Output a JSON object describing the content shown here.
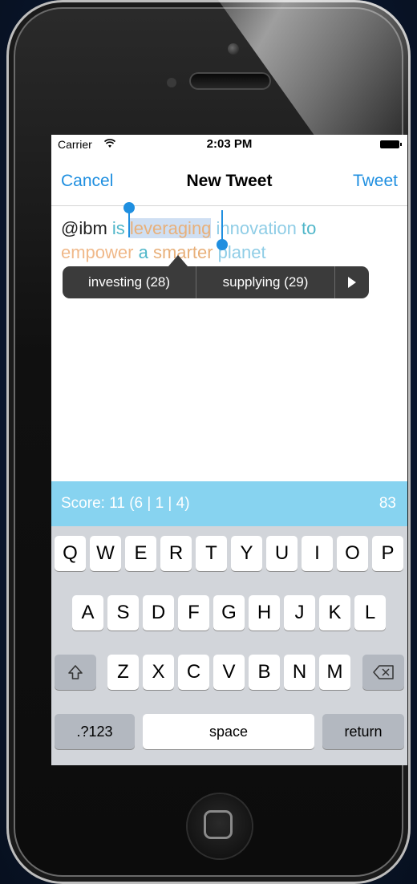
{
  "status": {
    "carrier": "Carrier",
    "time": "2:03 PM"
  },
  "nav": {
    "cancel": "Cancel",
    "title": "New Tweet",
    "tweet": "Tweet"
  },
  "tweet": {
    "line1": [
      {
        "text": "@ibm ",
        "color": "#222222"
      },
      {
        "text": "is ",
        "color": "#4fb6c9"
      },
      {
        "text": "leveraging",
        "color": "#e8b07a",
        "selected": true
      },
      {
        "text": " innovation ",
        "color": "#8fcde6"
      },
      {
        "text": "to",
        "color": "#4fb6c9"
      }
    ],
    "line2": [
      {
        "text": "empower ",
        "color": "#f0b98a"
      },
      {
        "text": "a ",
        "color": "#4fb6c9"
      },
      {
        "text": "smarter ",
        "color": "#e8b07a"
      },
      {
        "text": "planet",
        "color": "#8fcde6"
      }
    ]
  },
  "suggestions": {
    "items": [
      "investing (28)",
      "supplying (29)"
    ],
    "next_icon": "play-triangle-icon"
  },
  "score": {
    "label": "Score: 11 (6 | 1 | 4)",
    "remaining": "83",
    "bar_color": "#87d3f0"
  },
  "keyboard": {
    "row1": [
      "Q",
      "W",
      "E",
      "R",
      "T",
      "Y",
      "U",
      "I",
      "O",
      "P"
    ],
    "row2": [
      "A",
      "S",
      "D",
      "F",
      "G",
      "H",
      "J",
      "K",
      "L"
    ],
    "row3": [
      "Z",
      "X",
      "C",
      "V",
      "B",
      "N",
      "M"
    ],
    "shift_icon": "shift-arrow-icon",
    "delete_icon": "delete-backspace-icon",
    "numbers": ".?123",
    "space": "space",
    "return": "return"
  },
  "accent_color": "#1f8fe0"
}
